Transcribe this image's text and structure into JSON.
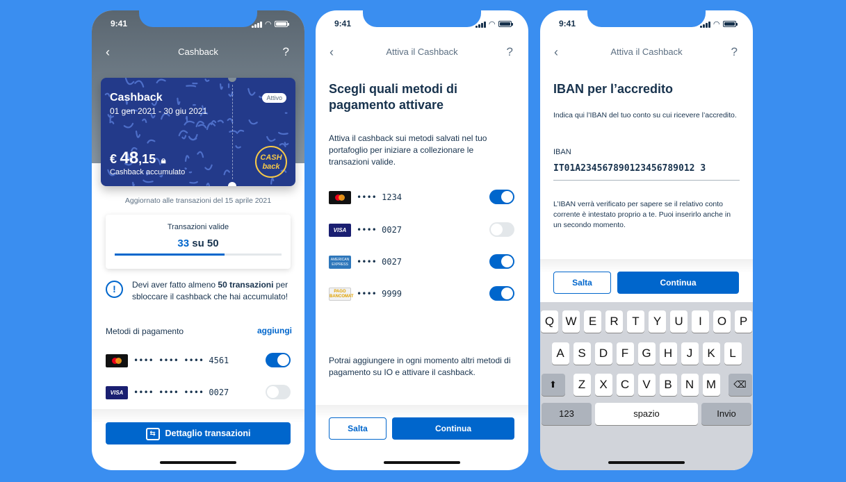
{
  "status_time": "9:41",
  "phone1": {
    "nav_title": "Cashback",
    "back_icon": "chevron-left-icon",
    "help_icon": "question-icon",
    "card": {
      "title": "Cashback",
      "dates": "01 gen 2021 - 30 giu 2021",
      "badge": "Attivo",
      "currency": "€",
      "amount_int": "48",
      "amount_dec": ",15",
      "amount_label": "Cashback accumulato",
      "logo_line1": "CASH",
      "logo_line2": "back"
    },
    "updated": "Aggiornato alle transazioni del 15 aprile 2021",
    "transactions": {
      "label": "Transazioni valide",
      "current": "33",
      "separator": "su",
      "total": "50",
      "progress": 0.66
    },
    "warning": {
      "pre": "Devi aver fatto almeno ",
      "bold": "50 transazioni",
      "post": " per sbloccare il cashback che hai accumulato!"
    },
    "methods_title": "Metodi di pagamento",
    "methods_add": "aggiungi",
    "methods": [
      {
        "brand": "mastercard",
        "number": "•••• •••• •••• 4561",
        "enabled": true
      },
      {
        "brand": "visa",
        "number": "•••• •••• •••• 0027",
        "enabled": false
      }
    ],
    "detail_button": "Dettaglio transazioni"
  },
  "phone2": {
    "nav_title": "Attiva il Cashback",
    "heading": "Scegli quali metodi di pagamento attivare",
    "intro": "Attiva il cashback sui metodi salvati nel tuo portafoglio per iniziare a collezionare le transazioni valide.",
    "methods": [
      {
        "brand": "mastercard",
        "number": "•••• 1234",
        "enabled": true
      },
      {
        "brand": "visa",
        "number": "•••• 0027",
        "enabled": false
      },
      {
        "brand": "amex",
        "number": "•••• 0027",
        "enabled": true
      },
      {
        "brand": "pagobancomat",
        "number": "•••• 9999",
        "enabled": true
      }
    ],
    "visa_text": "VISA",
    "amex_text": "AMERICAN EXPRESS",
    "pago_line1": "PAGO",
    "pago_line2": "BANCOMAT",
    "footer_text": "Potrai aggiungere in ogni momento altri metodi di pagamento su IO e attivare il cashback.",
    "skip": "Salta",
    "continue": "Continua"
  },
  "phone3": {
    "nav_title": "Attiva il Cashback",
    "heading": "IBAN per l’accredito",
    "intro": "Indica qui l’IBAN del tuo conto su cui ricevere l’accredito.",
    "iban_label": "IBAN",
    "iban_value": "IT01A234567890123456789012 3",
    "note": "L’IBAN verrà verificato per sapere se il relativo conto corrente è intestato proprio a te. Puoi inserirlo anche in un secondo momento.",
    "skip": "Salta",
    "continue": "Continua",
    "keyboard": {
      "row1": [
        "Q",
        "W",
        "E",
        "R",
        "T",
        "Y",
        "U",
        "I",
        "O",
        "P"
      ],
      "row2": [
        "A",
        "S",
        "D",
        "F",
        "G",
        "H",
        "J",
        "K",
        "L"
      ],
      "row3": [
        "Z",
        "X",
        "C",
        "V",
        "B",
        "N",
        "M"
      ],
      "shift_icon": "shift-icon",
      "delete_icon": "backspace-icon",
      "numbers": "123",
      "space": "spazio",
      "enter": "Invio"
    }
  },
  "colors": {
    "background": "#3a8ef0",
    "primary": "#0066cc",
    "text": "#17324d"
  }
}
